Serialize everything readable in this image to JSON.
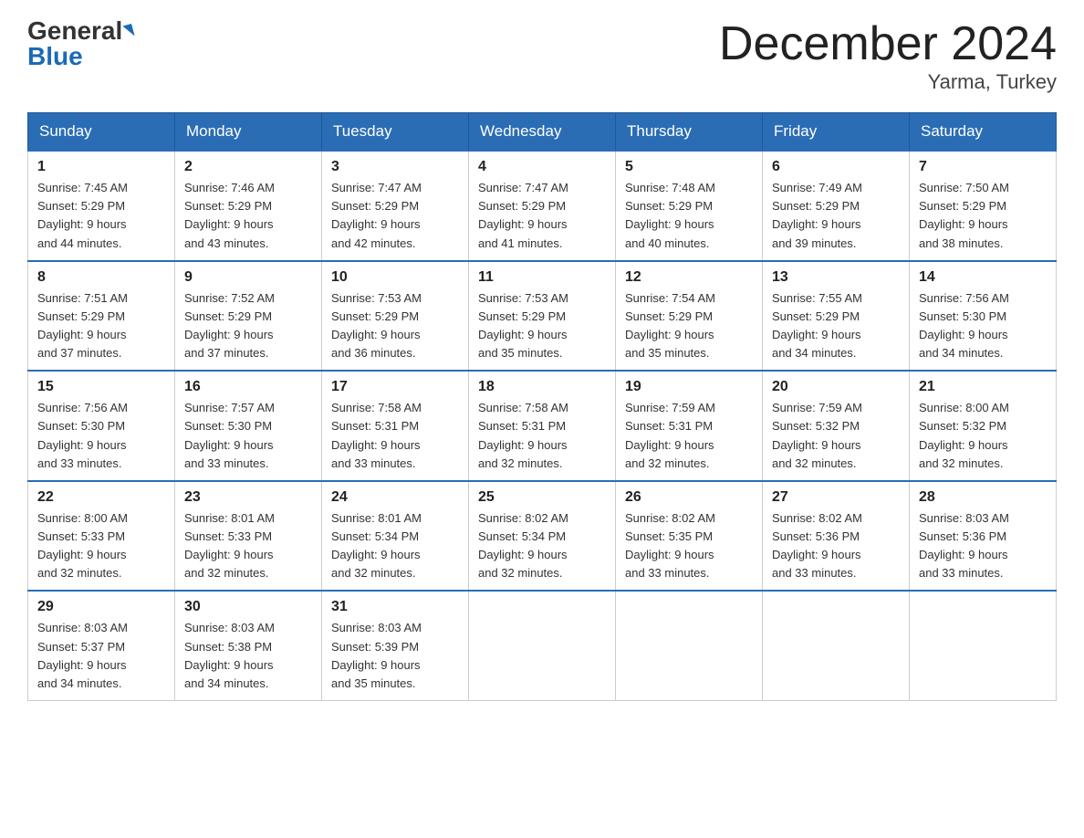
{
  "header": {
    "logo_general": "General",
    "logo_blue": "Blue",
    "month_title": "December 2024",
    "location": "Yarma, Turkey"
  },
  "weekdays": [
    "Sunday",
    "Monday",
    "Tuesday",
    "Wednesday",
    "Thursday",
    "Friday",
    "Saturday"
  ],
  "weeks": [
    [
      {
        "day": "1",
        "info": "Sunrise: 7:45 AM\nSunset: 5:29 PM\nDaylight: 9 hours\nand 44 minutes."
      },
      {
        "day": "2",
        "info": "Sunrise: 7:46 AM\nSunset: 5:29 PM\nDaylight: 9 hours\nand 43 minutes."
      },
      {
        "day": "3",
        "info": "Sunrise: 7:47 AM\nSunset: 5:29 PM\nDaylight: 9 hours\nand 42 minutes."
      },
      {
        "day": "4",
        "info": "Sunrise: 7:47 AM\nSunset: 5:29 PM\nDaylight: 9 hours\nand 41 minutes."
      },
      {
        "day": "5",
        "info": "Sunrise: 7:48 AM\nSunset: 5:29 PM\nDaylight: 9 hours\nand 40 minutes."
      },
      {
        "day": "6",
        "info": "Sunrise: 7:49 AM\nSunset: 5:29 PM\nDaylight: 9 hours\nand 39 minutes."
      },
      {
        "day": "7",
        "info": "Sunrise: 7:50 AM\nSunset: 5:29 PM\nDaylight: 9 hours\nand 38 minutes."
      }
    ],
    [
      {
        "day": "8",
        "info": "Sunrise: 7:51 AM\nSunset: 5:29 PM\nDaylight: 9 hours\nand 37 minutes."
      },
      {
        "day": "9",
        "info": "Sunrise: 7:52 AM\nSunset: 5:29 PM\nDaylight: 9 hours\nand 37 minutes."
      },
      {
        "day": "10",
        "info": "Sunrise: 7:53 AM\nSunset: 5:29 PM\nDaylight: 9 hours\nand 36 minutes."
      },
      {
        "day": "11",
        "info": "Sunrise: 7:53 AM\nSunset: 5:29 PM\nDaylight: 9 hours\nand 35 minutes."
      },
      {
        "day": "12",
        "info": "Sunrise: 7:54 AM\nSunset: 5:29 PM\nDaylight: 9 hours\nand 35 minutes."
      },
      {
        "day": "13",
        "info": "Sunrise: 7:55 AM\nSunset: 5:29 PM\nDaylight: 9 hours\nand 34 minutes."
      },
      {
        "day": "14",
        "info": "Sunrise: 7:56 AM\nSunset: 5:30 PM\nDaylight: 9 hours\nand 34 minutes."
      }
    ],
    [
      {
        "day": "15",
        "info": "Sunrise: 7:56 AM\nSunset: 5:30 PM\nDaylight: 9 hours\nand 33 minutes."
      },
      {
        "day": "16",
        "info": "Sunrise: 7:57 AM\nSunset: 5:30 PM\nDaylight: 9 hours\nand 33 minutes."
      },
      {
        "day": "17",
        "info": "Sunrise: 7:58 AM\nSunset: 5:31 PM\nDaylight: 9 hours\nand 33 minutes."
      },
      {
        "day": "18",
        "info": "Sunrise: 7:58 AM\nSunset: 5:31 PM\nDaylight: 9 hours\nand 32 minutes."
      },
      {
        "day": "19",
        "info": "Sunrise: 7:59 AM\nSunset: 5:31 PM\nDaylight: 9 hours\nand 32 minutes."
      },
      {
        "day": "20",
        "info": "Sunrise: 7:59 AM\nSunset: 5:32 PM\nDaylight: 9 hours\nand 32 minutes."
      },
      {
        "day": "21",
        "info": "Sunrise: 8:00 AM\nSunset: 5:32 PM\nDaylight: 9 hours\nand 32 minutes."
      }
    ],
    [
      {
        "day": "22",
        "info": "Sunrise: 8:00 AM\nSunset: 5:33 PM\nDaylight: 9 hours\nand 32 minutes."
      },
      {
        "day": "23",
        "info": "Sunrise: 8:01 AM\nSunset: 5:33 PM\nDaylight: 9 hours\nand 32 minutes."
      },
      {
        "day": "24",
        "info": "Sunrise: 8:01 AM\nSunset: 5:34 PM\nDaylight: 9 hours\nand 32 minutes."
      },
      {
        "day": "25",
        "info": "Sunrise: 8:02 AM\nSunset: 5:34 PM\nDaylight: 9 hours\nand 32 minutes."
      },
      {
        "day": "26",
        "info": "Sunrise: 8:02 AM\nSunset: 5:35 PM\nDaylight: 9 hours\nand 33 minutes."
      },
      {
        "day": "27",
        "info": "Sunrise: 8:02 AM\nSunset: 5:36 PM\nDaylight: 9 hours\nand 33 minutes."
      },
      {
        "day": "28",
        "info": "Sunrise: 8:03 AM\nSunset: 5:36 PM\nDaylight: 9 hours\nand 33 minutes."
      }
    ],
    [
      {
        "day": "29",
        "info": "Sunrise: 8:03 AM\nSunset: 5:37 PM\nDaylight: 9 hours\nand 34 minutes."
      },
      {
        "day": "30",
        "info": "Sunrise: 8:03 AM\nSunset: 5:38 PM\nDaylight: 9 hours\nand 34 minutes."
      },
      {
        "day": "31",
        "info": "Sunrise: 8:03 AM\nSunset: 5:39 PM\nDaylight: 9 hours\nand 35 minutes."
      },
      null,
      null,
      null,
      null
    ]
  ]
}
